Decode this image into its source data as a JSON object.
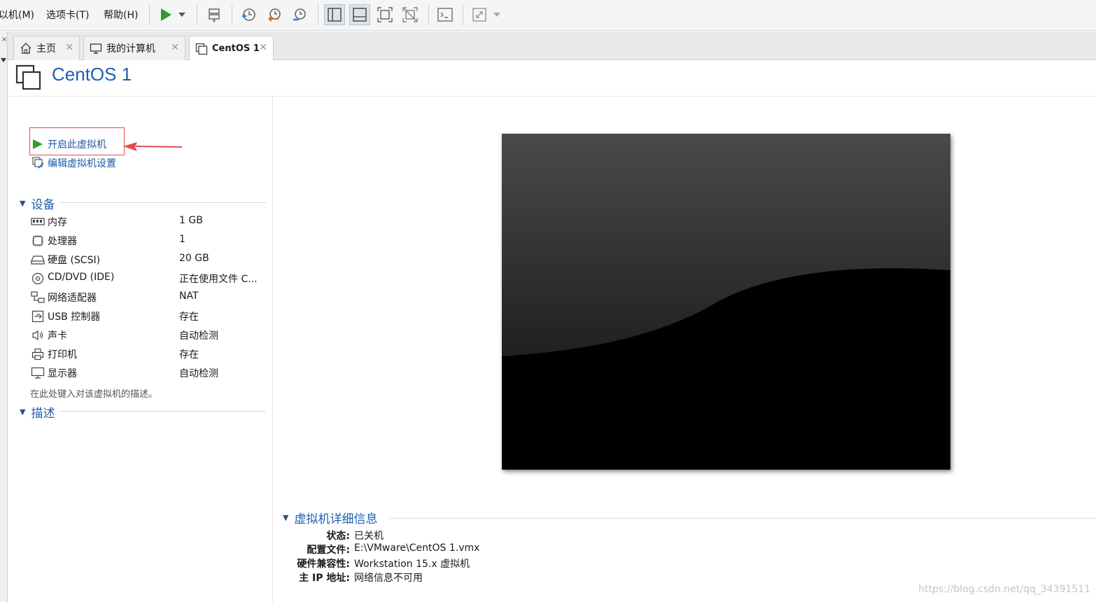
{
  "menu": {
    "items": [
      "以机(M)",
      "选项卡(T)",
      "帮助(H)"
    ]
  },
  "toolbar": {
    "buttons": [
      "play-icon",
      "dropdown-icon",
      "send-keys-icon",
      "snapshot-icon",
      "revert-snapshot-icon",
      "snapshot-manager-icon",
      "library-view-icon",
      "thumbnail-bar-icon",
      "full-screen-icon",
      "unity-icon",
      "console-icon",
      "stretch-icon"
    ]
  },
  "tabs": [
    {
      "label": "主页",
      "icon": "home-icon"
    },
    {
      "label": "我的计算机",
      "icon": "computer-icon"
    },
    {
      "label": "CentOS 1",
      "icon": "vm-icon"
    }
  ],
  "vm": {
    "title": "CentOS 1"
  },
  "actions": {
    "power_on": "开启此虚拟机",
    "edit_settings": "编辑虚拟机设置"
  },
  "devices": {
    "heading": "设备",
    "items": [
      {
        "name": "内存",
        "value": "1 GB",
        "icon": "memory-icon"
      },
      {
        "name": "处理器",
        "value": "1",
        "icon": "cpu-icon"
      },
      {
        "name": "硬盘 (SCSI)",
        "value": "20 GB",
        "icon": "hard-disk-icon"
      },
      {
        "name": "CD/DVD (IDE)",
        "value": "正在使用文件 C...",
        "icon": "cd-dvd-icon"
      },
      {
        "name": "网络适配器",
        "value": "NAT",
        "icon": "network-adapter-icon"
      },
      {
        "name": "USB 控制器",
        "value": "存在",
        "icon": "usb-icon"
      },
      {
        "name": "声卡",
        "value": "自动检测",
        "icon": "sound-icon"
      },
      {
        "name": "打印机",
        "value": "存在",
        "icon": "printer-icon"
      },
      {
        "name": "显示器",
        "value": "自动检测",
        "icon": "display-icon"
      }
    ]
  },
  "description": {
    "heading": "描述",
    "placeholder": "在此处键入对该虚拟机的描述。"
  },
  "details": {
    "heading": "虚拟机详细信息",
    "rows": [
      {
        "label": "状态:",
        "value": "已关机"
      },
      {
        "label": "配置文件:",
        "value": "E:\\VMware\\CentOS 1.vmx"
      },
      {
        "label": "硬件兼容性:",
        "value": "Workstation 15.x 虚拟机"
      },
      {
        "label": "主 IP 地址:",
        "value": "网络信息不可用"
      }
    ]
  },
  "watermark": "https://blog.csdn.net/qq_34391511",
  "colors": {
    "accent": "#1f5fb0",
    "play_green": "#2e9e2e",
    "highlight_red": "#e24b4b"
  }
}
